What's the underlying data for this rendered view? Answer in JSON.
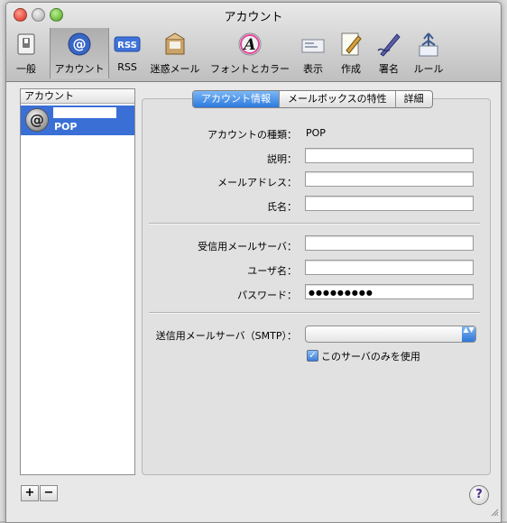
{
  "window": {
    "title": "アカウント"
  },
  "toolbar": {
    "items": [
      {
        "label": "一般",
        "icon": "switch-icon"
      },
      {
        "label": "アカウント",
        "icon": "at-sign-icon"
      },
      {
        "label": "RSS",
        "icon": "rss-icon"
      },
      {
        "label": "迷惑メール",
        "icon": "junk-mail-icon"
      },
      {
        "label": "フォントとカラー",
        "icon": "font-color-icon"
      },
      {
        "label": "表示",
        "icon": "view-icon"
      },
      {
        "label": "作成",
        "icon": "compose-icon"
      },
      {
        "label": "署名",
        "icon": "signature-icon"
      },
      {
        "label": "ルール",
        "icon": "rules-icon"
      }
    ],
    "rss_badge": "RSS",
    "font_badge": "A"
  },
  "sidebar": {
    "header": "アカウント",
    "accounts": [
      {
        "type": "POP",
        "avatar_glyph": "@"
      }
    ],
    "add_label": "+",
    "remove_label": "−"
  },
  "tabs": {
    "items": [
      "アカウント情報",
      "メールボックスの特性",
      "詳細"
    ],
    "active": 0
  },
  "form": {
    "account_type_label": "アカウントの種類：",
    "account_type_value": "POP",
    "description_label": "説明：",
    "email_label": "メールアドレス：",
    "fullname_label": "氏名：",
    "incoming_label": "受信用メールサーバ：",
    "username_label": "ユーザ名：",
    "password_label": "パスワード：",
    "password_value": "●●●●●●●●●",
    "smtp_label": "送信用メールサーバ（SMTP）：",
    "smtp_arrows": "▲▼",
    "only_server_label": "このサーバのみを使用"
  },
  "help": {
    "label": "?"
  }
}
